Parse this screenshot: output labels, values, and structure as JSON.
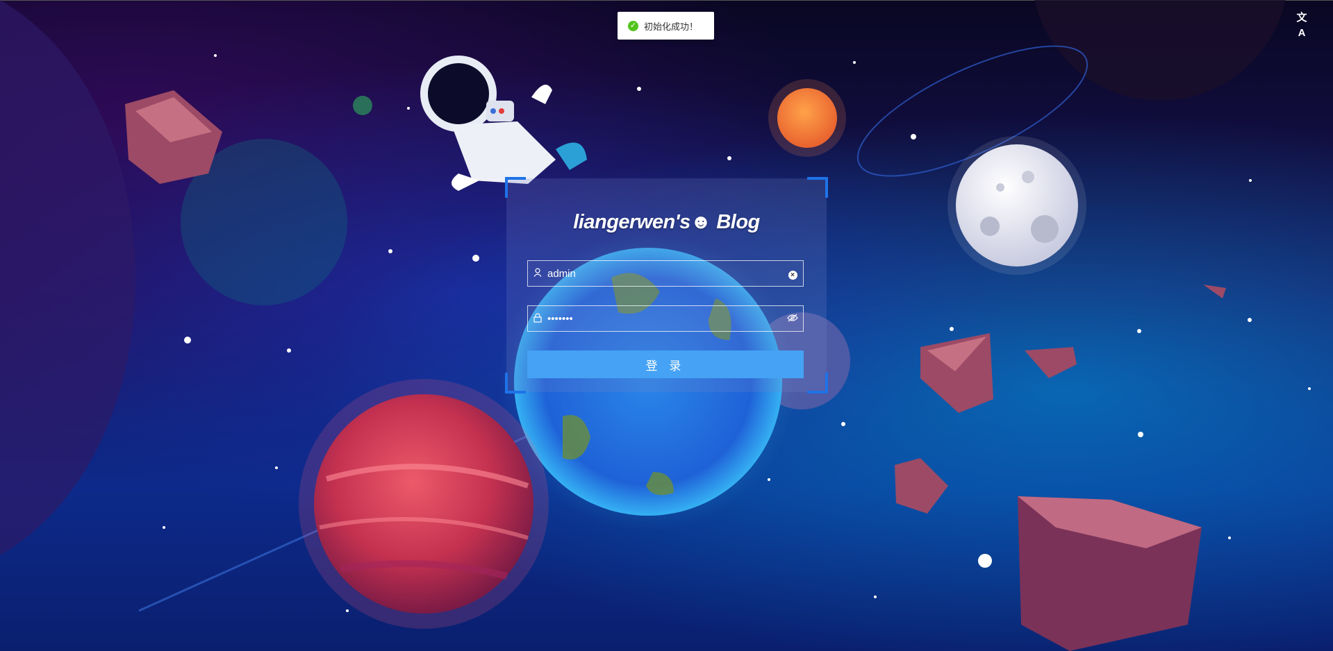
{
  "toast": {
    "text": "初始化成功！",
    "icon": "check-circle-icon"
  },
  "header": {
    "language_icon": "文A"
  },
  "login": {
    "brand_title": "liangerwen's☻ Blog",
    "username": {
      "value": "admin",
      "icon": "user-icon",
      "clear_icon": "×"
    },
    "password": {
      "value": "•••••••",
      "icon": "lock-icon",
      "toggle_icon": "eye-off-icon"
    },
    "submit_label": "登 录"
  },
  "colors": {
    "accent": "#45a2f5",
    "corner": "#1e73e8",
    "toast_success": "#52c41a"
  }
}
